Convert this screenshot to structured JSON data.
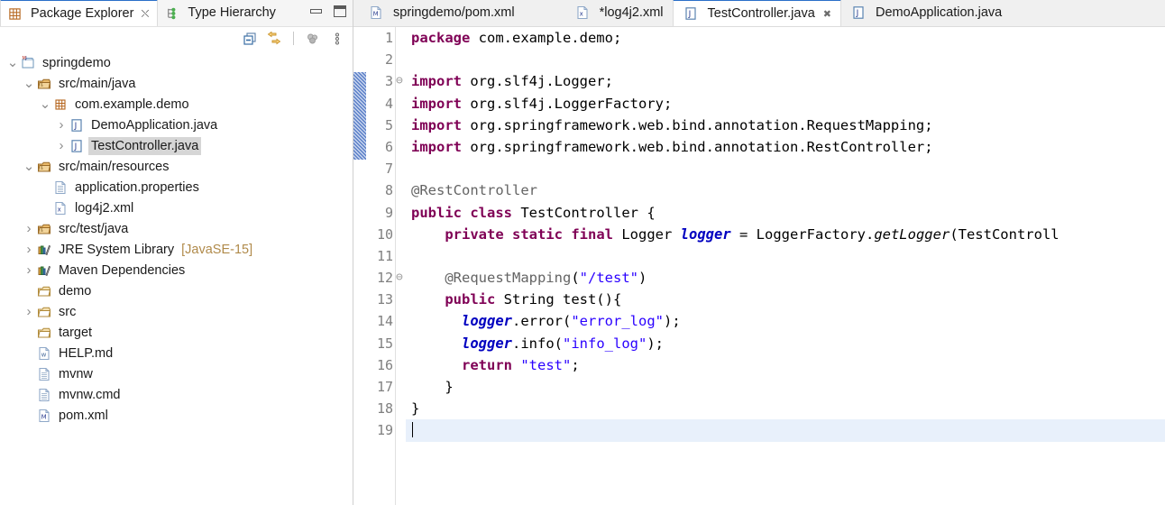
{
  "view_panel": {
    "tabs": [
      {
        "label": "Package Explorer",
        "icon": "package-explorer-icon",
        "active": true,
        "closable": true
      },
      {
        "label": "Type Hierarchy",
        "icon": "type-hierarchy-icon",
        "active": false,
        "closable": false
      }
    ],
    "window_buttons": {
      "minimize": "Minimize",
      "maximize": "Maximize"
    },
    "toolbar": [
      {
        "name": "collapse-all-button",
        "tooltip": "Collapse All"
      },
      {
        "name": "link-with-editor-button",
        "tooltip": "Link with Editor"
      },
      {
        "name": "view-menu-button",
        "tooltip": "View Menu"
      },
      {
        "name": "more-options-button",
        "tooltip": "More"
      }
    ]
  },
  "tree": {
    "items": [
      {
        "label": "springdemo",
        "suffix": "",
        "indent": 0,
        "twisty": "expanded",
        "icon": "maven-project-icon",
        "selected": false
      },
      {
        "label": "src/main/java",
        "suffix": "",
        "indent": 1,
        "twisty": "expanded",
        "icon": "source-folder-icon",
        "selected": false
      },
      {
        "label": "com.example.demo",
        "suffix": "",
        "indent": 2,
        "twisty": "expanded",
        "icon": "package-icon",
        "selected": false
      },
      {
        "label": "DemoApplication.java",
        "suffix": "",
        "indent": 3,
        "twisty": "collapsed",
        "icon": "java-file-icon",
        "selected": false
      },
      {
        "label": "TestController.java",
        "suffix": "",
        "indent": 3,
        "twisty": "collapsed",
        "icon": "java-file-icon",
        "selected": true
      },
      {
        "label": "src/main/resources",
        "suffix": "",
        "indent": 1,
        "twisty": "expanded",
        "icon": "source-folder-icon",
        "selected": false
      },
      {
        "label": "application.properties",
        "suffix": "",
        "indent": 2,
        "twisty": "none",
        "icon": "properties-file-icon",
        "selected": false
      },
      {
        "label": "log4j2.xml",
        "suffix": "",
        "indent": 2,
        "twisty": "none",
        "icon": "xml-file-icon",
        "selected": false
      },
      {
        "label": "src/test/java",
        "suffix": "",
        "indent": 1,
        "twisty": "collapsed",
        "icon": "source-folder-icon",
        "selected": false
      },
      {
        "label": "JRE System Library",
        "suffix": "[JavaSE-15]",
        "indent": 1,
        "twisty": "collapsed",
        "icon": "library-icon",
        "selected": false
      },
      {
        "label": "Maven Dependencies",
        "suffix": "",
        "indent": 1,
        "twisty": "collapsed",
        "icon": "library-icon",
        "selected": false
      },
      {
        "label": "demo",
        "suffix": "",
        "indent": 1,
        "twisty": "none",
        "icon": "folder-icon",
        "selected": false
      },
      {
        "label": "src",
        "suffix": "",
        "indent": 1,
        "twisty": "collapsed",
        "icon": "folder-icon",
        "selected": false
      },
      {
        "label": "target",
        "suffix": "",
        "indent": 1,
        "twisty": "none",
        "icon": "folder-icon",
        "selected": false
      },
      {
        "label": "HELP.md",
        "suffix": "",
        "indent": 1,
        "twisty": "none",
        "icon": "markdown-file-icon",
        "selected": false
      },
      {
        "label": "mvnw",
        "suffix": "",
        "indent": 1,
        "twisty": "none",
        "icon": "text-file-icon",
        "selected": false
      },
      {
        "label": "mvnw.cmd",
        "suffix": "",
        "indent": 1,
        "twisty": "none",
        "icon": "text-file-icon",
        "selected": false
      },
      {
        "label": "pom.xml",
        "suffix": "",
        "indent": 1,
        "twisty": "none",
        "icon": "maven-pom-icon",
        "selected": false
      }
    ]
  },
  "editor": {
    "tabs": [
      {
        "label": "springdemo/pom.xml",
        "icon": "maven-pom-icon",
        "active": false,
        "dirty": false,
        "closable": false
      },
      {
        "label": "*log4j2.xml",
        "icon": "xml-file-icon",
        "active": false,
        "dirty": true,
        "closable": false
      },
      {
        "label": "TestController.java",
        "icon": "java-file-icon",
        "active": true,
        "dirty": false,
        "closable": true
      },
      {
        "label": "DemoApplication.java",
        "icon": "java-file-icon",
        "active": false,
        "dirty": false,
        "closable": false
      }
    ],
    "line_numbers": [
      "1",
      "2",
      "3",
      "4",
      "5",
      "6",
      "7",
      "8",
      "9",
      "10",
      "11",
      "12",
      "13",
      "14",
      "15",
      "16",
      "17",
      "18",
      "19"
    ],
    "fold_markers": {
      "3": "collapse",
      "12": "collapse"
    },
    "current_line": 19,
    "import_marker_lines": [
      3,
      4,
      5,
      6
    ],
    "lines": [
      {
        "n": 1,
        "tokens": [
          {
            "t": "package",
            "c": "kw"
          },
          {
            "t": " com.example.demo;",
            "c": ""
          }
        ]
      },
      {
        "n": 2,
        "tokens": []
      },
      {
        "n": 3,
        "tokens": [
          {
            "t": "import",
            "c": "kw"
          },
          {
            "t": " org.slf4j.Logger;",
            "c": ""
          }
        ]
      },
      {
        "n": 4,
        "tokens": [
          {
            "t": "import",
            "c": "kw"
          },
          {
            "t": " org.slf4j.LoggerFactory;",
            "c": ""
          }
        ]
      },
      {
        "n": 5,
        "tokens": [
          {
            "t": "import",
            "c": "kw"
          },
          {
            "t": " org.springframework.web.bind.annotation.RequestMapping;",
            "c": ""
          }
        ]
      },
      {
        "n": 6,
        "tokens": [
          {
            "t": "import",
            "c": "kw"
          },
          {
            "t": " org.springframework.web.bind.annotation.RestController;",
            "c": ""
          }
        ]
      },
      {
        "n": 7,
        "tokens": []
      },
      {
        "n": 8,
        "tokens": [
          {
            "t": "@RestController",
            "c": "ann"
          }
        ]
      },
      {
        "n": 9,
        "tokens": [
          {
            "t": "public",
            "c": "kw"
          },
          {
            "t": " ",
            "c": ""
          },
          {
            "t": "class",
            "c": "kw"
          },
          {
            "t": " TestController {",
            "c": ""
          }
        ]
      },
      {
        "n": 10,
        "tokens": [
          {
            "t": "    ",
            "c": ""
          },
          {
            "t": "private",
            "c": "kw"
          },
          {
            "t": " ",
            "c": ""
          },
          {
            "t": "static",
            "c": "kw"
          },
          {
            "t": " ",
            "c": ""
          },
          {
            "t": "final",
            "c": "kw"
          },
          {
            "t": " Logger ",
            "c": ""
          },
          {
            "t": "logger",
            "c": "fld"
          },
          {
            "t": " = LoggerFactory.",
            "c": ""
          },
          {
            "t": "getLogger",
            "c": "mth"
          },
          {
            "t": "(TestControll",
            "c": ""
          }
        ]
      },
      {
        "n": 11,
        "tokens": []
      },
      {
        "n": 12,
        "tokens": [
          {
            "t": "    ",
            "c": ""
          },
          {
            "t": "@RequestMapping",
            "c": "ann"
          },
          {
            "t": "(",
            "c": ""
          },
          {
            "t": "\"/test\"",
            "c": "str"
          },
          {
            "t": ")",
            "c": ""
          }
        ]
      },
      {
        "n": 13,
        "tokens": [
          {
            "t": "    ",
            "c": ""
          },
          {
            "t": "public",
            "c": "kw"
          },
          {
            "t": " String test(){",
            "c": ""
          }
        ]
      },
      {
        "n": 14,
        "tokens": [
          {
            "t": "      ",
            "c": ""
          },
          {
            "t": "logger",
            "c": "fld"
          },
          {
            "t": ".error(",
            "c": ""
          },
          {
            "t": "\"error_log\"",
            "c": "str"
          },
          {
            "t": ");",
            "c": ""
          }
        ]
      },
      {
        "n": 15,
        "tokens": [
          {
            "t": "      ",
            "c": ""
          },
          {
            "t": "logger",
            "c": "fld"
          },
          {
            "t": ".info(",
            "c": ""
          },
          {
            "t": "\"info_log\"",
            "c": "str"
          },
          {
            "t": ");",
            "c": ""
          }
        ]
      },
      {
        "n": 16,
        "tokens": [
          {
            "t": "      ",
            "c": ""
          },
          {
            "t": "return",
            "c": "kw"
          },
          {
            "t": " ",
            "c": ""
          },
          {
            "t": "\"test\"",
            "c": "str"
          },
          {
            "t": ";",
            "c": ""
          }
        ]
      },
      {
        "n": 17,
        "tokens": [
          {
            "t": "    }",
            "c": ""
          }
        ]
      },
      {
        "n": 18,
        "tokens": [
          {
            "t": "}",
            "c": ""
          }
        ]
      },
      {
        "n": 19,
        "tokens": []
      }
    ]
  },
  "colors": {
    "keyword": "#7f0055",
    "string": "#2a00ff",
    "annotation": "#646464",
    "static_field": "#0000c0",
    "line_number": "#808080",
    "current_line_bg": "#e8f0fb",
    "tab_accent": "#2a6fc9",
    "selection_bg": "#d6d6d6"
  }
}
